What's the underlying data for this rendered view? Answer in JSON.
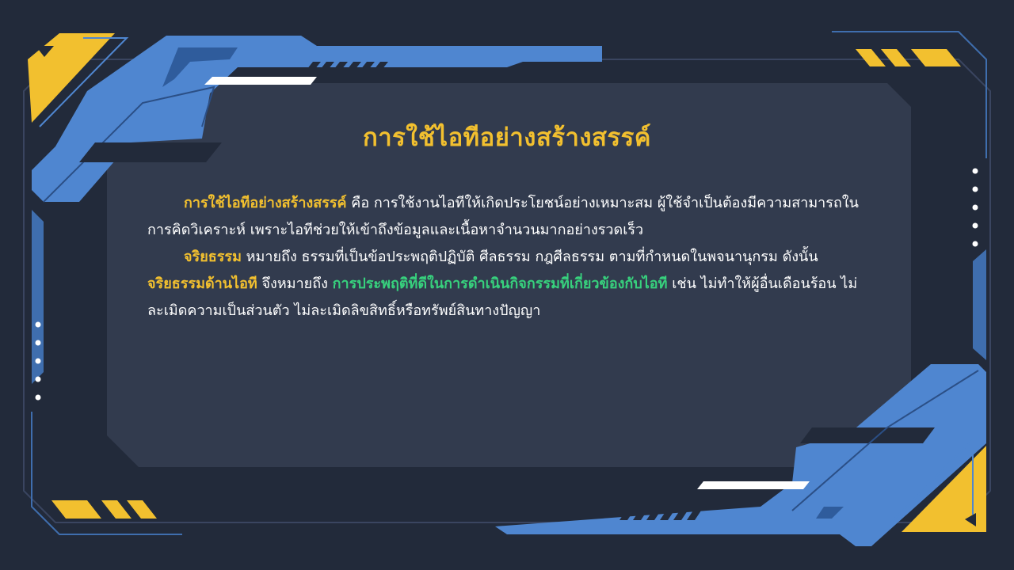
{
  "slide": {
    "title": "การใช้ไอทีอย่างสร้างสรรค์",
    "paragraphs": [
      {
        "term": "การใช้ไอทีอย่างสร้างสรรค์",
        "text": " คือ การใช้งานไอทีให้เกิดประโยชน์อย่างเหมาะสม ผู้ใช้จำเป็นต้องมีความสามารถในการคิดวิเคราะห์ เพราะไอทีช่วยให้เข้าถึงข้อมูลและเนื้อหาจำนวนมากอย่างรวดเร็ว"
      },
      {
        "term": "จริยธรรม",
        "text1": " หมายถึง ธรรมที่เป็นข้อประพฤติปฏิบัติ ศีลธรรม กฎศีลธรรม ตามที่กำหนดในพจนานุกรม ดังนั้น ",
        "term2": "จริยธรรมด้านไอที",
        "text2": " จึงหมายถึง ",
        "term3": "การประพฤติที่ดีในการดำเนินกิจกรรมที่เกี่ยวข้องกับไอที",
        "text3": " เช่น ไม่ทำให้ผู้อื่นเดือนร้อน ไม่ละเมิดความเป็นส่วนตัว ไม่ละเมิดลิขสิทธิ์หรือทรัพย์สินทางปัญญา"
      }
    ]
  },
  "colors": {
    "background": "#222a3a",
    "panel": "#323b4e",
    "accent_blue": "#4f86d0",
    "accent_yellow": "#f2c02f",
    "highlight_green": "#37d17d",
    "text": "#ffffff"
  }
}
